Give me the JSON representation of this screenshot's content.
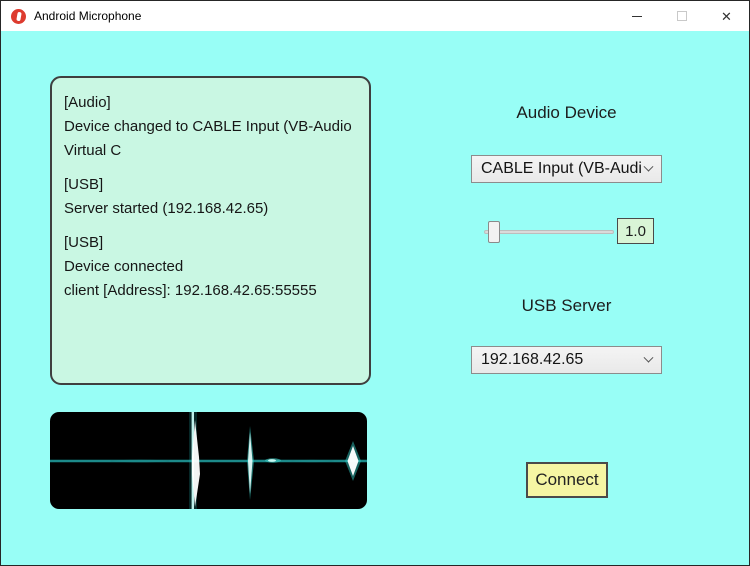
{
  "colors": {
    "client_bg": "#98FEF6",
    "log_bg": "#C9F7E3",
    "value_box_bg": "#D9F5D6",
    "connect_bg": "#F5F5A3",
    "app_icon_red": "#DD3B2F",
    "waveform_line": "#1F9E9E"
  },
  "window": {
    "title": "Android Microphone",
    "minimize_glyph": "–",
    "close_glyph": "✕"
  },
  "log": {
    "p1": "[Audio]\nDevice changed to CABLE Input (VB-Audio\nVirtual C",
    "p2": "[USB]\nServer started (192.168.42.65)",
    "p3": "[USB]\nDevice connected\nclient [Address]: 192.168.42.65:55555"
  },
  "audio": {
    "section_label": "Audio Device",
    "device_selected": "CABLE Input (VB-Audi",
    "volume_value": "1.0"
  },
  "usb": {
    "section_label": "USB Server",
    "server_selected": "192.168.42.65"
  },
  "actions": {
    "connect_label": "Connect"
  }
}
